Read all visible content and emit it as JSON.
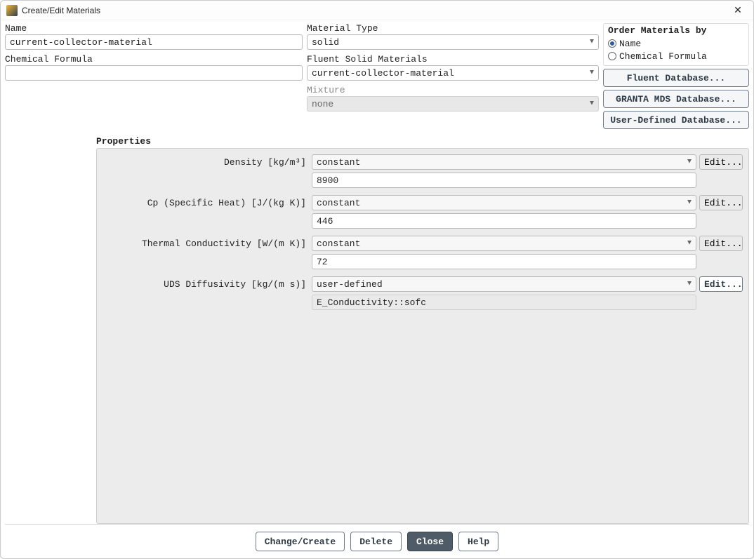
{
  "window": {
    "title": "Create/Edit Materials",
    "close_glyph": "✕"
  },
  "fields": {
    "name_label": "Name",
    "name_value": "current-collector-material",
    "formula_label": "Chemical Formula",
    "formula_value": "",
    "material_type_label": "Material Type",
    "material_type_value": "solid",
    "fluent_solid_label": "Fluent Solid Materials",
    "fluent_solid_value": "current-collector-material",
    "mixture_label": "Mixture",
    "mixture_value": "none"
  },
  "order_by": {
    "label": "Order Materials by",
    "option_name": "Name",
    "option_formula": "Chemical Formula"
  },
  "db_buttons": {
    "fluent": "Fluent Database...",
    "granta": "GRANTA MDS Database...",
    "user": "User-Defined Database..."
  },
  "properties": {
    "label": "Properties",
    "edit_label": "Edit...",
    "rows": {
      "density": {
        "label": "Density [kg/m³]",
        "method": "constant",
        "value": "8900"
      },
      "cp": {
        "label": "Cp (Specific Heat) [J/(kg K)]",
        "method": "constant",
        "value": "446"
      },
      "thermal": {
        "label": "Thermal Conductivity [W/(m K)]",
        "method": "constant",
        "value": "72"
      },
      "uds": {
        "label": "UDS Diffusivity [kg/(m s)]",
        "method": "user-defined",
        "value": "E_Conductivity::sofc"
      }
    }
  },
  "footer": {
    "change_create": "Change/Create",
    "delete": "Delete",
    "close": "Close",
    "help": "Help"
  },
  "glyphs": {
    "caret": "▼"
  }
}
